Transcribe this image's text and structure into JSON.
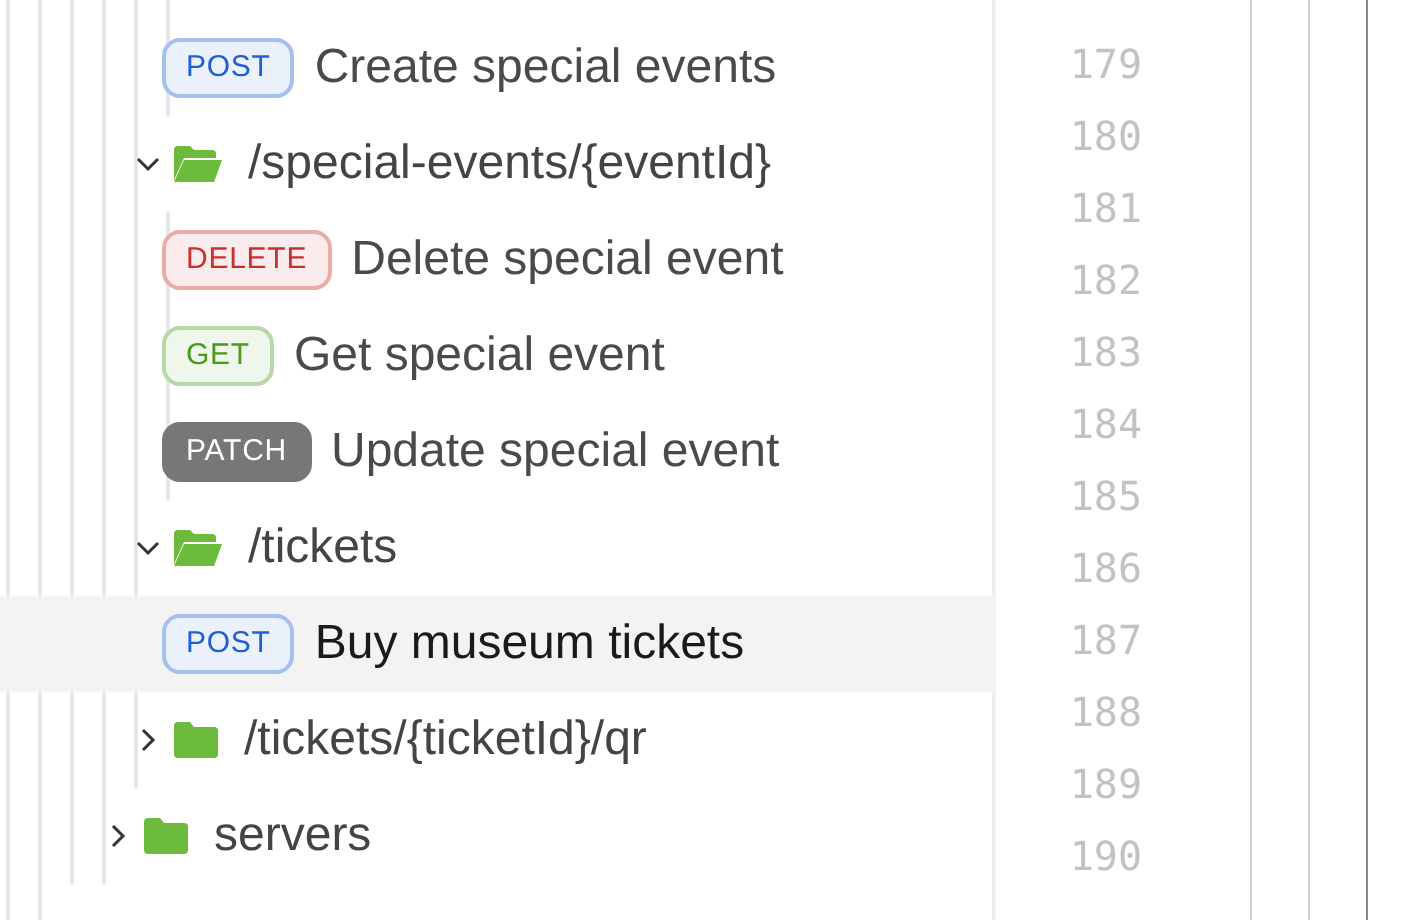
{
  "tree": [
    {
      "kind": "group",
      "children": [
        {
          "kind": "group",
          "children": [
            {
              "kind": "operation",
              "method": "POST",
              "color": "#1d5fd6",
              "filled": false,
              "label": "Create special events",
              "selected": false
            }
          ]
        },
        {
          "kind": "folder",
          "label": "/special-events/{eventId}",
          "expanded": true,
          "children": [
            {
              "kind": "operation",
              "method": "DELETE",
              "color": "#c9302c",
              "filled": false,
              "label": "Delete special event",
              "selected": false
            },
            {
              "kind": "operation",
              "method": "GET",
              "color": "#4a9a20",
              "filled": false,
              "label": "Get special event",
              "selected": false
            },
            {
              "kind": "operation",
              "method": "PATCH",
              "color": "#777777",
              "filled": true,
              "label": "Update special event",
              "selected": false
            }
          ]
        },
        {
          "kind": "folder",
          "label": "/tickets",
          "expanded": true,
          "children": [
            {
              "kind": "operation",
              "method": "POST",
              "color": "#1d5fd6",
              "filled": false,
              "label": "Buy museum tickets",
              "selected": true
            }
          ]
        },
        {
          "kind": "folder",
          "label": "/tickets/{ticketId}/qr",
          "expanded": false
        }
      ]
    },
    {
      "kind": "folder",
      "label": "servers",
      "expanded": false
    }
  ],
  "line_numbers": [
    "179",
    "180",
    "181",
    "182",
    "183",
    "184",
    "185",
    "186",
    "187",
    "188",
    "189",
    "190"
  ]
}
